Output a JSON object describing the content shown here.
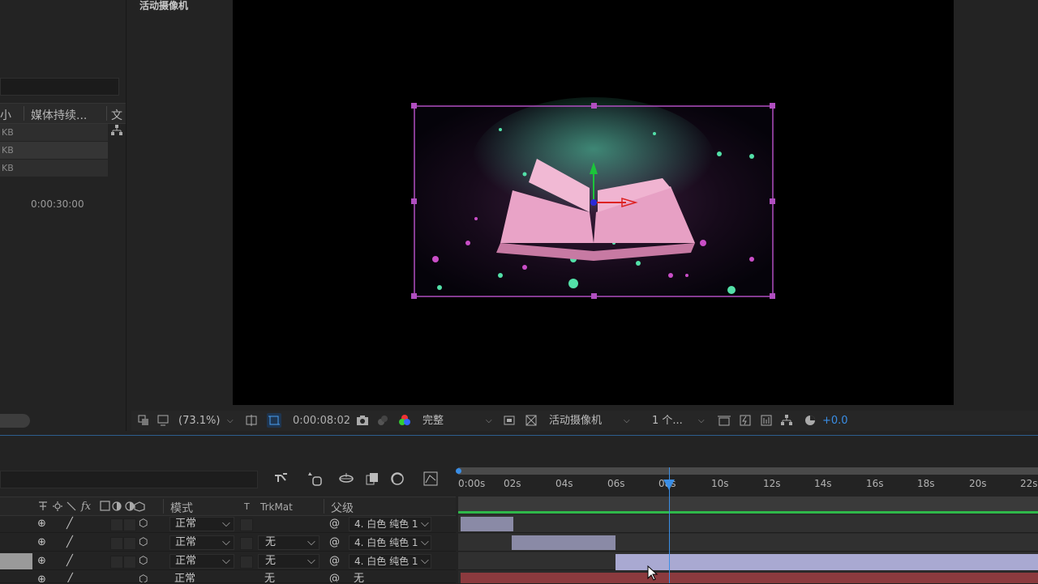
{
  "viewer": {
    "title": "活动摄像机",
    "zoom": "(73.1%)",
    "timecode": "0:00:08:02",
    "resolution": "完整",
    "camera": "活动摄像机",
    "views": "1 个...",
    "exposure": "+0.0"
  },
  "project": {
    "columns": [
      "小",
      "媒体持续...",
      "文"
    ],
    "rows": [
      "KB",
      "KB",
      "KB"
    ],
    "duration": "0:00:30:00"
  },
  "timeline": {
    "headers": {
      "mode": "模式",
      "t": "T",
      "trkmat": "TrkMat",
      "parent": "父级"
    },
    "layers": [
      {
        "mode": "正常",
        "trkmat": "",
        "parent": "4. 白色 纯色 1"
      },
      {
        "mode": "正常",
        "trkmat": "无",
        "parent": "4. 白色 纯色 1"
      },
      {
        "mode": "正常",
        "trkmat": "无",
        "parent": "4. 白色 纯色 1"
      },
      {
        "mode": "正常",
        "trkmat": "无",
        "parent": "无"
      }
    ],
    "ruler": [
      "0:00s",
      "02s",
      "04s",
      "06s",
      "08s",
      "10s",
      "12s",
      "14s",
      "16s",
      "18s",
      "20s",
      "22s"
    ]
  },
  "colors": {
    "accent": "#3a8ee6",
    "selection": "#b04ec0",
    "clip": "#8a8aa6",
    "clip_selected": "#a9a9d2",
    "clip_red": "#8b3a3e",
    "workarea_green": "#2fb84a"
  }
}
